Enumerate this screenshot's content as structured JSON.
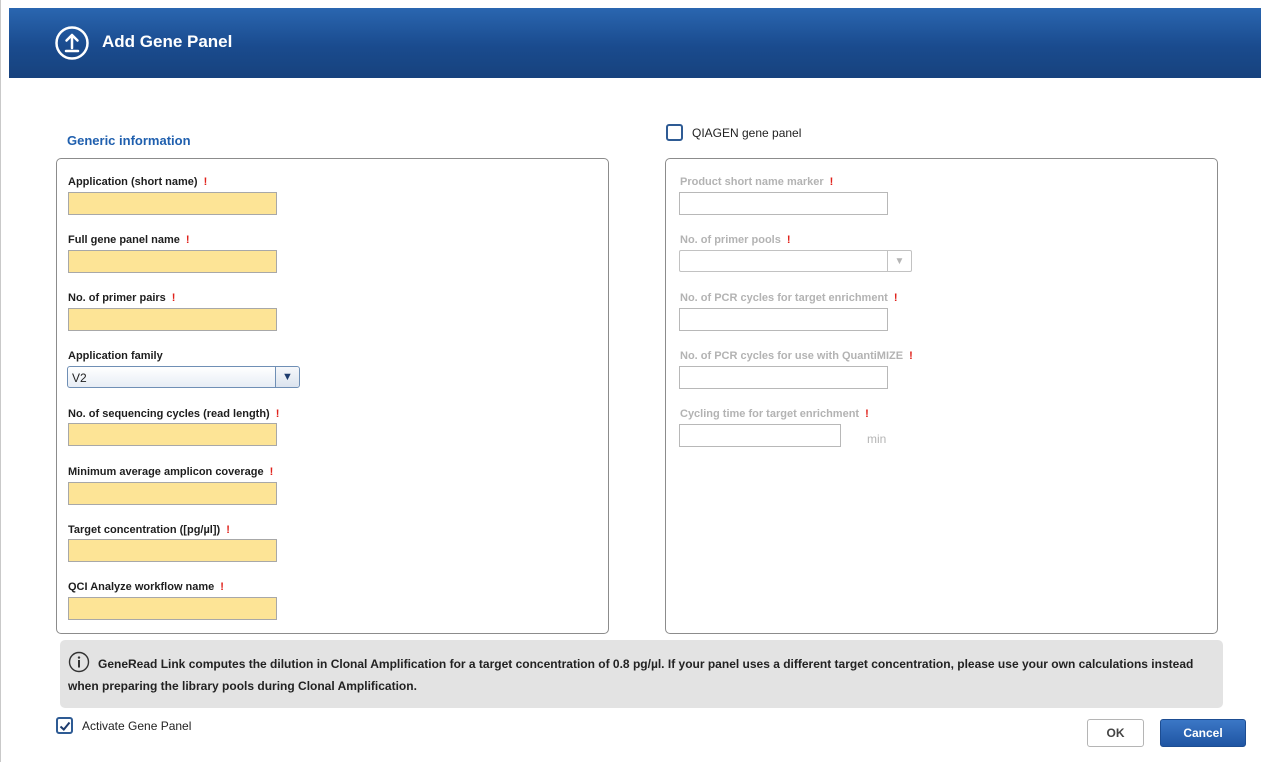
{
  "dialog": {
    "title": "Add Gene Panel",
    "icon": "upload-circle-icon"
  },
  "generic": {
    "section_title": "Generic information",
    "fields": {
      "app_short": {
        "label": "Application (short name)",
        "required": "!",
        "value": ""
      },
      "full_name": {
        "label": "Full gene panel name",
        "required": "!",
        "value": ""
      },
      "primer_pairs": {
        "label": "No. of primer pairs",
        "required": "!",
        "value": ""
      },
      "app_family": {
        "label": "Application family",
        "value": "V2"
      },
      "seq_cycles": {
        "label": "No. of sequencing cycles (read length)",
        "required": "!",
        "value": ""
      },
      "min_coverage": {
        "label": "Minimum average amplicon coverage",
        "required": "!",
        "value": ""
      },
      "target_conc": {
        "label": "Target concentration ([pg/µl])",
        "required": "!",
        "value": ""
      },
      "qci_workflow": {
        "label": "QCI Analyze workflow name",
        "required": "!",
        "value": ""
      }
    }
  },
  "qiagen": {
    "checkbox_label": "QIAGEN gene panel",
    "checked": false,
    "fields": {
      "product_marker": {
        "label": "Product short name marker",
        "required": "!",
        "value": ""
      },
      "primer_pools": {
        "label": "No. of primer pools",
        "required": "!",
        "value": ""
      },
      "pcr_cycles_target": {
        "label": "No. of PCR cycles for target enrichment",
        "required": "!",
        "value": ""
      },
      "pcr_cycles_quantimize": {
        "label": "No. of PCR cycles for use with QuantiMIZE",
        "required": "!",
        "value": ""
      },
      "cycling_time": {
        "label": "Cycling time for target enrichment",
        "required": "!",
        "value": "",
        "unit": "min"
      }
    }
  },
  "info": {
    "icon": "info-icon",
    "text": "GeneRead Link computes the dilution in Clonal Amplification for a target concentration of 0.8 pg/µl. If your panel uses a different target concentration, please use your own calculations instead when preparing the library pools during Clonal Amplification."
  },
  "activate": {
    "label": "Activate Gene Panel",
    "checked": true
  },
  "buttons": {
    "ok": "OK",
    "cancel": "Cancel"
  },
  "colors": {
    "titlebar": "#1a4b8e",
    "required_marker": "#e0221b",
    "required_input_bg": "#fde496",
    "section_title": "#1f5fae",
    "cancel_button": "#1f55a3"
  }
}
